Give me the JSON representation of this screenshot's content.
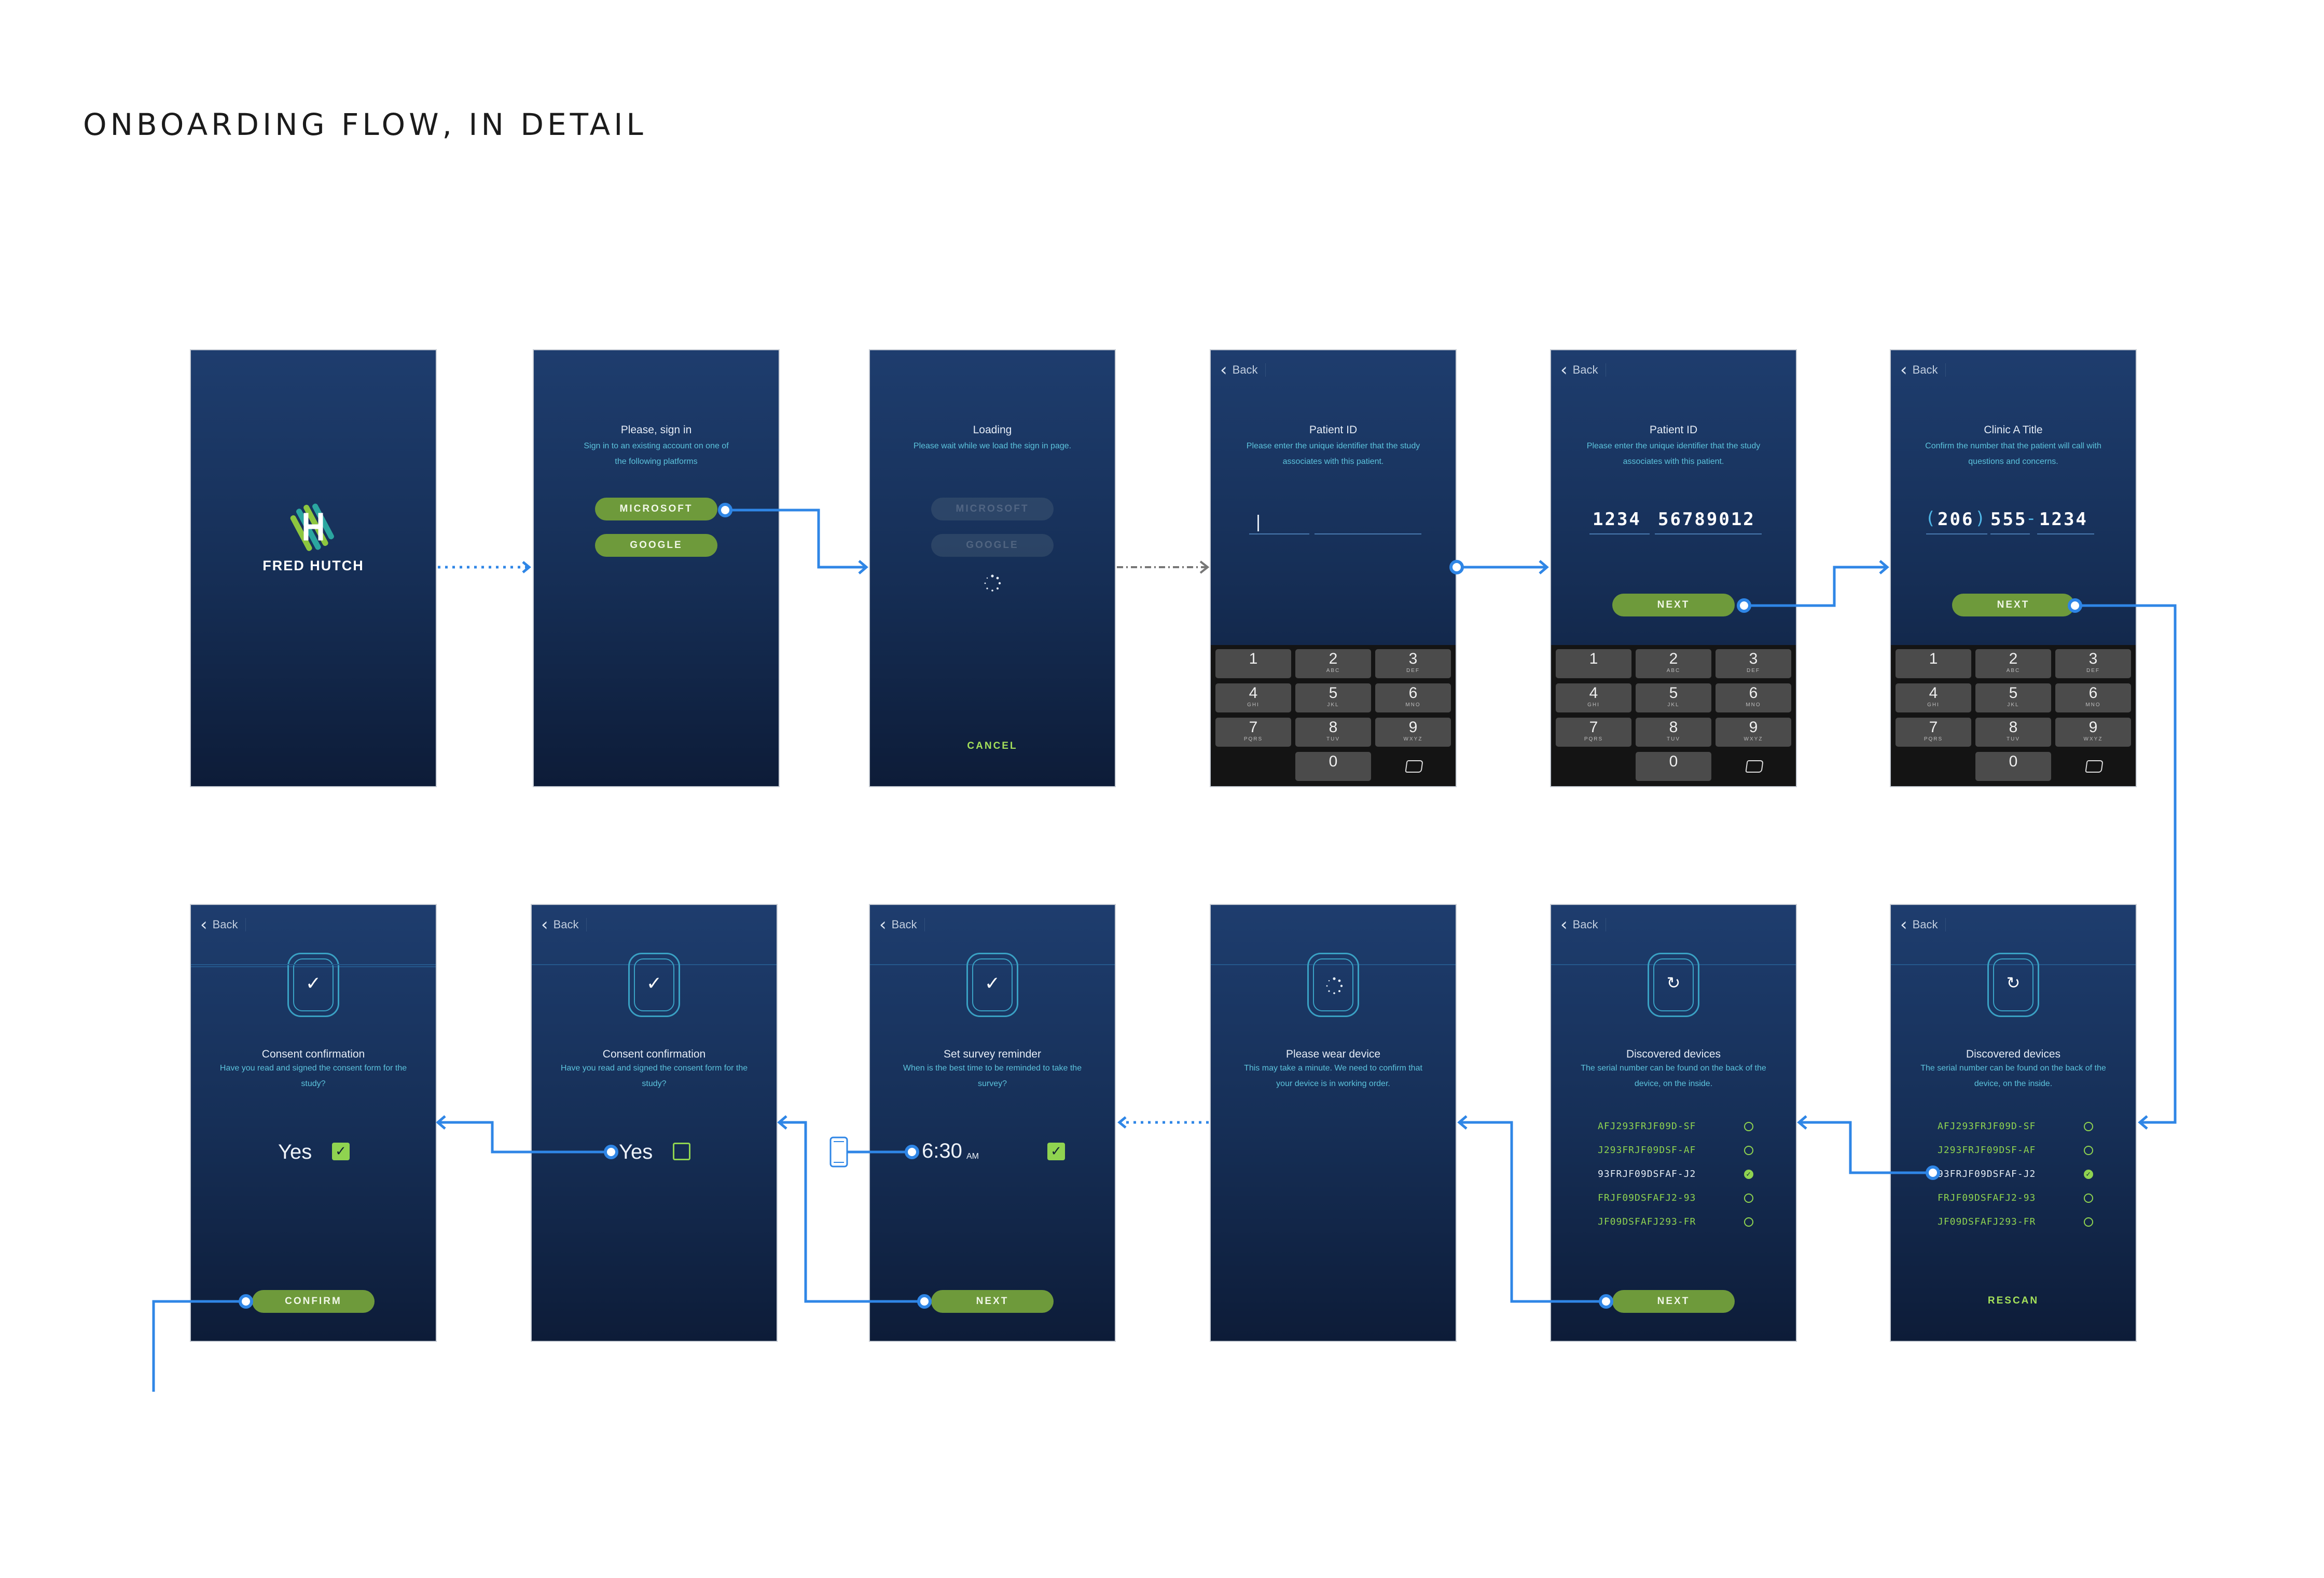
{
  "page": {
    "title": "ONBOARDING FLOW, IN DETAIL"
  },
  "colors": {
    "accent_line": "#2f86e6",
    "button_green": "#6e9a3b",
    "text_green": "#a4e05a",
    "screen_top": "#1e3d6e",
    "screen_bottom": "#0d1c38",
    "subtitle_cyan": "#5cc3dc"
  },
  "common": {
    "back": "Back"
  },
  "keypad": [
    {
      "d": "1",
      "l": ""
    },
    {
      "d": "2",
      "l": "ABC"
    },
    {
      "d": "3",
      "l": "DEF"
    },
    {
      "d": "4",
      "l": "GHI"
    },
    {
      "d": "5",
      "l": "JKL"
    },
    {
      "d": "6",
      "l": "MNO"
    },
    {
      "d": "7",
      "l": "PQRS"
    },
    {
      "d": "8",
      "l": "TUV"
    },
    {
      "d": "9",
      "l": "WXYZ"
    },
    {
      "d": "0",
      "l": ""
    }
  ],
  "s1": {
    "logo_text": "FRED HUTCH"
  },
  "s2": {
    "title": "Please, sign in",
    "subtitle": "Sign in to an existing account on one of the following platforms",
    "microsoft": "MICROSOFT",
    "google": "GOOGLE"
  },
  "s3": {
    "title": "Loading",
    "subtitle": "Please wait while we load the sign in page.",
    "microsoft": "MICROSOFT",
    "google": "GOOGLE",
    "cancel": "CANCEL"
  },
  "s4": {
    "title": "Patient ID",
    "subtitle": "Please enter the unique identifier that the study associates with this patient."
  },
  "s5": {
    "title": "Patient ID",
    "subtitle": "Please enter the unique identifier that the study associates with this patient.",
    "id_part1": "1234",
    "id_part2": "56789012",
    "next": "NEXT"
  },
  "s6": {
    "title": "Clinic A Title",
    "subtitle": "Confirm the number that the patient will call with questions and concerns.",
    "phone_area": "206",
    "phone_mid": "555",
    "phone_end": "1234",
    "next": "NEXT"
  },
  "s7": {
    "title": "Discovered devices",
    "subtitle": "The serial number can be found on the back of the device, on the inside.",
    "devices": [
      "AFJ293FRJF09D-SF",
      "J293FRJF09DSF-AF",
      "93FRJF09DSFAF-J2",
      "FRJF09DSFAFJ2-93",
      "JF09DSFAFJ293-FR"
    ],
    "rescan": "RESCAN"
  },
  "s8": {
    "title": "Discovered devices",
    "subtitle": "The serial number can be found on the back of the device, on the inside.",
    "devices": [
      "AFJ293FRJF09D-SF",
      "J293FRJF09DSF-AF",
      "93FRJF09DSFAF-J2",
      "FRJF09DSFAFJ2-93",
      "JF09DSFAFJ293-FR"
    ],
    "next": "NEXT"
  },
  "s9": {
    "title": "Please wear device",
    "subtitle": "This may take a minute. We need to confirm that your device is in working order."
  },
  "s10": {
    "title": "Set survey reminder",
    "subtitle": "When is the best time to be reminded to take the survey?",
    "time": "6:30",
    "ampm": "AM",
    "next": "NEXT"
  },
  "s11": {
    "title": "Consent confirmation",
    "subtitle": "Have you read and signed the consent form for the study?",
    "yes": "Yes"
  },
  "s12": {
    "title": "Consent confirmation",
    "subtitle": "Have you read and signed the consent form for the study?",
    "yes": "Yes",
    "confirm": "CONFIRM"
  }
}
